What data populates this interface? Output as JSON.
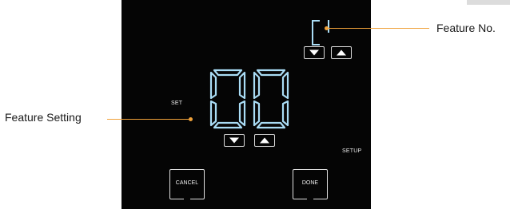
{
  "callouts": {
    "feature_no": "Feature No.",
    "feature_setting": "Feature Setting"
  },
  "display": {
    "feature_number": "01",
    "setting_value": "00"
  },
  "labels": {
    "set": "SET",
    "setup": "SETUP"
  },
  "buttons": {
    "cancel": "CANCEL",
    "done": "DONE"
  },
  "icons": {
    "feature_down": "triangle-down-icon",
    "feature_up": "triangle-up-icon",
    "setting_down": "triangle-down-icon",
    "setting_up": "triangle-up-icon"
  },
  "colors": {
    "screen_bg": "#050505",
    "digit_color": "#a9dcf5",
    "callout_accent": "#f0a23a"
  }
}
